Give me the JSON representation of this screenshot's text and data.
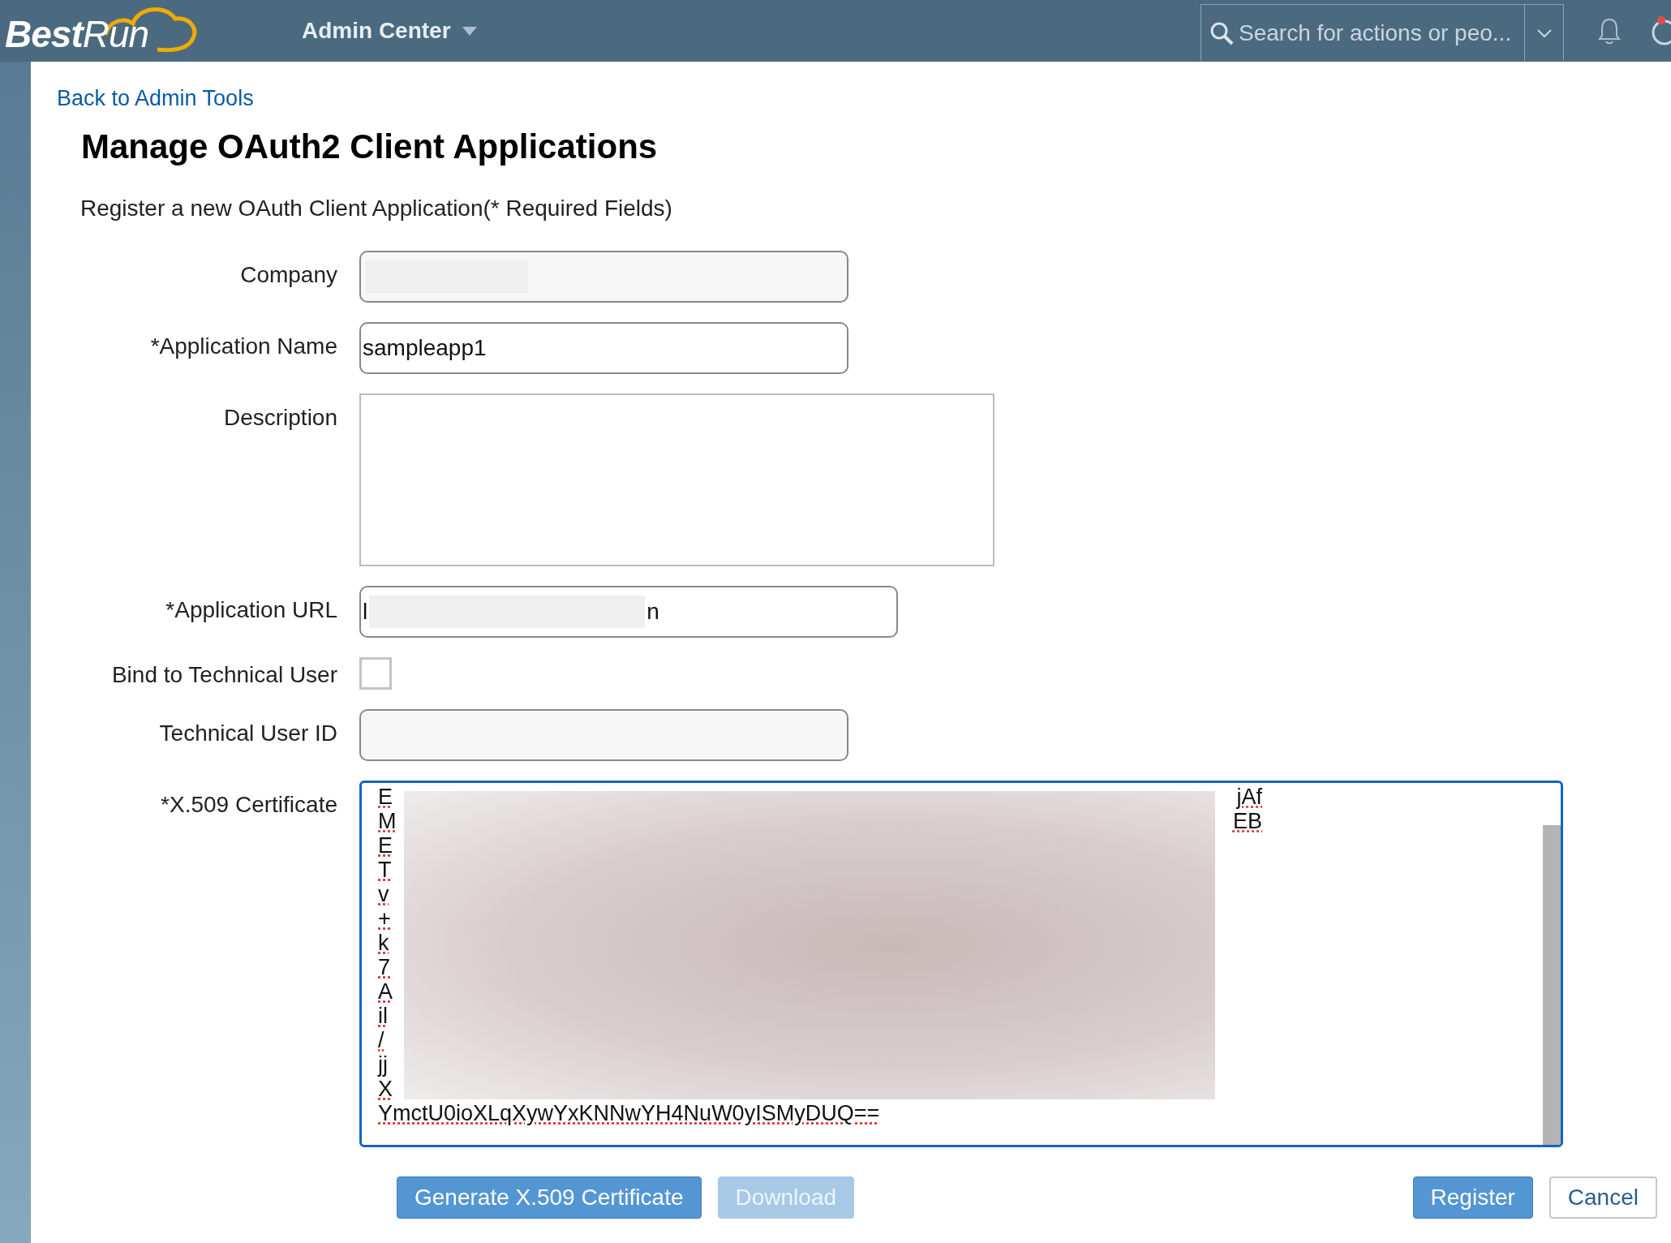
{
  "header": {
    "logo": {
      "bold": "Best",
      "light": "Run"
    },
    "menu": "Admin Center",
    "search": {
      "placeholder": "Search for actions or peo..."
    }
  },
  "back_link": "Back to Admin Tools",
  "title": "Manage OAuth2 Client Applications",
  "subtitle": "Register a new OAuth Client Application(* Required Fields)",
  "fields": [
    {
      "kind": "text",
      "label": "Company",
      "redacted": true
    },
    {
      "kind": "text",
      "label": "*Application Name",
      "value": "sampleapp1"
    },
    {
      "kind": "area",
      "label": "Description"
    },
    {
      "kind": "url",
      "label": "*Application URL",
      "start": "l",
      "end": "n",
      "redacted": true
    },
    {
      "kind": "checkbox",
      "label": "Bind to Technical User",
      "checked": false
    },
    {
      "kind": "text",
      "label": "Technical User ID"
    },
    {
      "kind": "cert",
      "label": "*X.509 Certificate",
      "focused": true,
      "redacted": true,
      "lines": [
        {
          "start": "E",
          "end": "jAf"
        },
        {
          "start": "M",
          "end": "EB"
        },
        {
          "start": "E"
        },
        {
          "start": "T"
        },
        {
          "start": "v"
        },
        {
          "start": "+"
        },
        {
          "start": "k"
        },
        {
          "start": "7"
        },
        {
          "start": "A"
        },
        {
          "start": "il"
        },
        {
          "start": "/"
        },
        {
          "start": "jj"
        },
        {
          "start": "X"
        },
        {
          "start": "YmctU0ioXLqXywYxKNNwYH4NuW0yISMyDUQ=="
        }
      ]
    }
  ],
  "left_buttons": [
    {
      "label": "Generate X.509 Certificate",
      "disabled": false,
      "kind": "primary"
    },
    {
      "label": "Download",
      "disabled": true,
      "kind": "primary"
    }
  ],
  "right_buttons": [
    {
      "label": "Register",
      "disabled": false,
      "kind": "primary"
    },
    {
      "label": "Cancel",
      "disabled": false,
      "kind": "secondary"
    }
  ]
}
